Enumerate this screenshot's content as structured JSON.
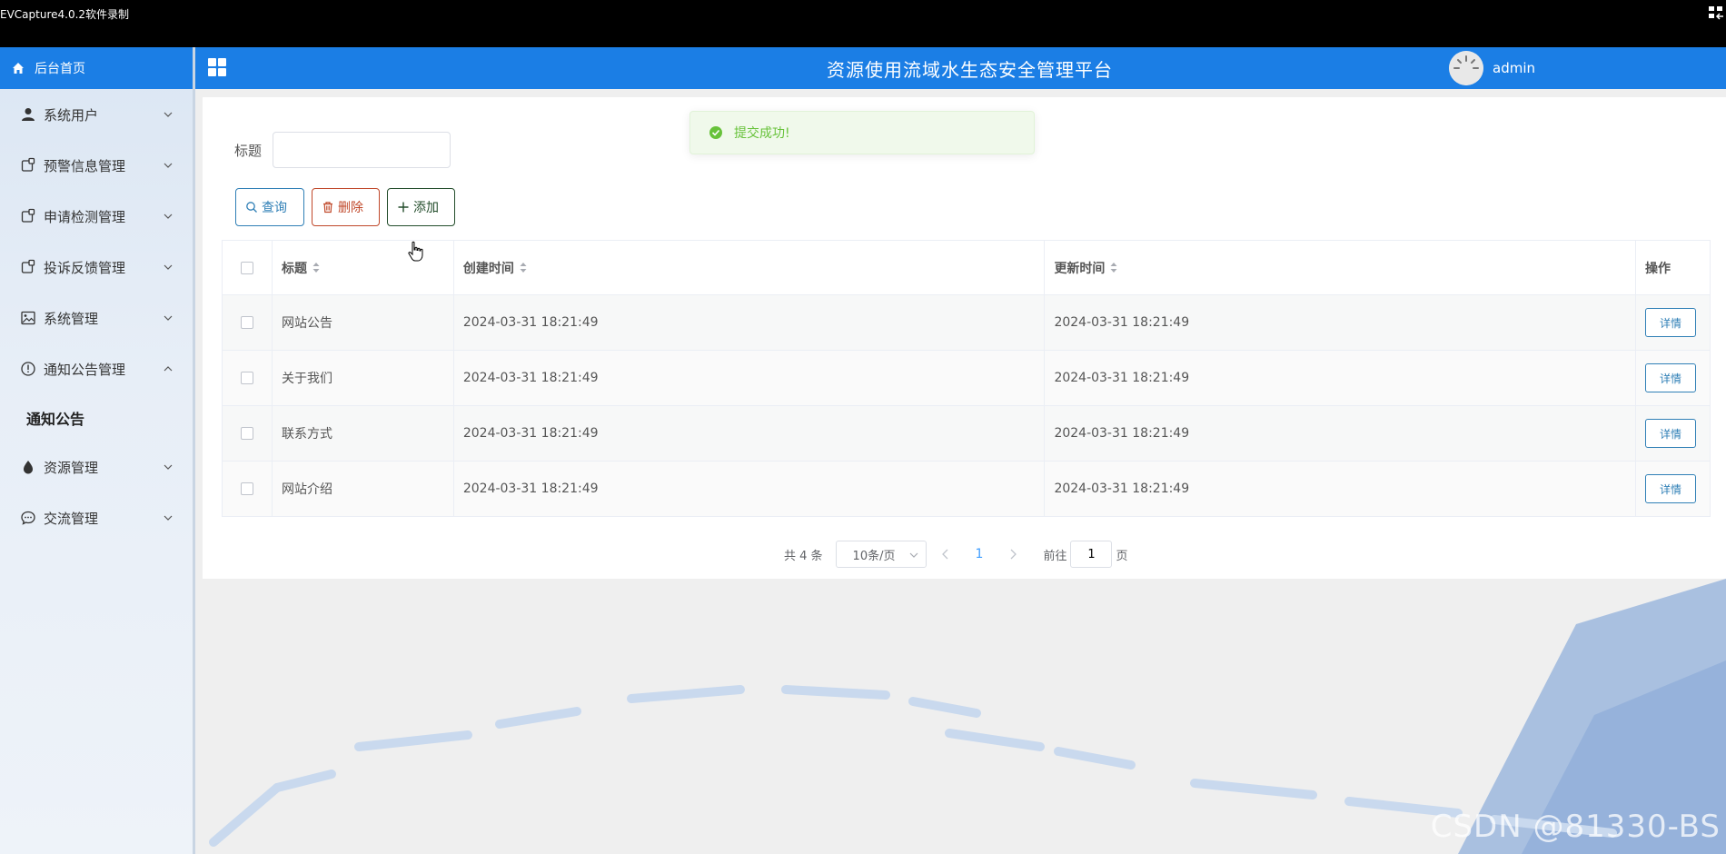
{
  "recorder": {
    "title": "EVCapture4.0.2软件录制"
  },
  "header": {
    "title": "资源使用流域水生态安全管理平台",
    "username": "admin"
  },
  "toast": {
    "message": "提交成功!"
  },
  "sidebar": {
    "home": "后台首页",
    "items": [
      {
        "label": "系统用户",
        "icon": "user-icon",
        "expanded": false
      },
      {
        "label": "预警信息管理",
        "icon": "document-icon",
        "expanded": false
      },
      {
        "label": "申请检测管理",
        "icon": "document-icon",
        "expanded": false
      },
      {
        "label": "投诉反馈管理",
        "icon": "document-icon",
        "expanded": false
      },
      {
        "label": "系统管理",
        "icon": "image-icon",
        "expanded": false
      },
      {
        "label": "通知公告管理",
        "icon": "info-icon",
        "expanded": true
      },
      {
        "label": "资源管理",
        "icon": "water-drop-icon",
        "expanded": false
      },
      {
        "label": "交流管理",
        "icon": "chat-icon",
        "expanded": false
      }
    ],
    "submenu": {
      "label": "通知公告"
    }
  },
  "search": {
    "label": "标题",
    "value": ""
  },
  "buttons": {
    "query": "查询",
    "delete": "删除",
    "add": "添加"
  },
  "table": {
    "columns": [
      "标题",
      "创建时间",
      "更新时间",
      "操作"
    ],
    "rows": [
      {
        "title": "网站公告",
        "created": "2024-03-31 18:21:49",
        "updated": "2024-03-31 18:21:49",
        "action": "详情"
      },
      {
        "title": "关于我们",
        "created": "2024-03-31 18:21:49",
        "updated": "2024-03-31 18:21:49",
        "action": "详情"
      },
      {
        "title": "联系方式",
        "created": "2024-03-31 18:21:49",
        "updated": "2024-03-31 18:21:49",
        "action": "详情"
      },
      {
        "title": "网站介绍",
        "created": "2024-03-31 18:21:49",
        "updated": "2024-03-31 18:21:49",
        "action": "详情"
      }
    ]
  },
  "pagination": {
    "total": "共 4 条",
    "page_size": "10条/页",
    "current": "1",
    "goto_label": "前往",
    "goto_value": "1",
    "page_suffix": "页"
  },
  "watermark": "CSDN @81330-BS",
  "colors": {
    "primary": "#1b7ee5",
    "success": "#67c23a",
    "danger": "#c0482a",
    "query": "#2f7fb6"
  }
}
